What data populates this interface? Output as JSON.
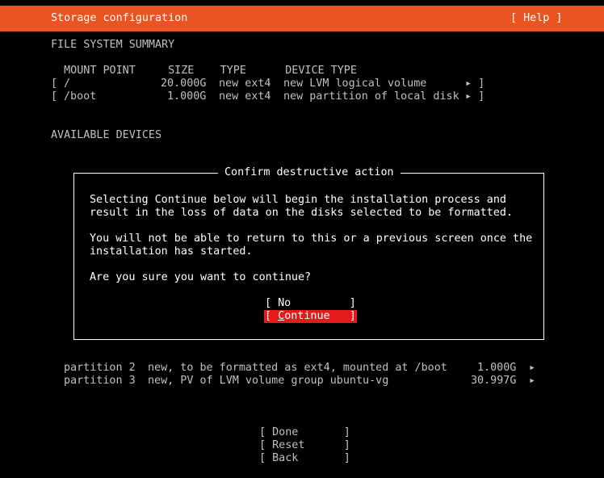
{
  "header": {
    "title": "Storage configuration",
    "help_label": "[ Help ]",
    "accent_color": "#e95420"
  },
  "summary": {
    "heading": "FILE SYSTEM SUMMARY",
    "columns": "  MOUNT POINT     SIZE    TYPE      DEVICE TYPE",
    "rows": [
      {
        "bracket": "[",
        "mount": "/",
        "size": "20.000G",
        "type": "new ext4",
        "device_type": "new LVM logical volume",
        "arrow": "▸ ]"
      },
      {
        "bracket": "[",
        "mount": "/boot",
        "size": "1.000G",
        "type": "new ext4",
        "device_type": "new partition of local disk",
        "arrow": "▸ ]"
      }
    ]
  },
  "available_devices": {
    "heading": "AVAILABLE DEVICES",
    "partitions": [
      {
        "name": "partition 2",
        "desc": "new, to be formatted as ext4, mounted at /boot",
        "size": "1.000G",
        "arrow": "▸"
      },
      {
        "name": "partition 3",
        "desc": "new, PV of LVM volume group ubuntu-vg",
        "size": "30.997G",
        "arrow": "▸"
      }
    ]
  },
  "dialog": {
    "title": "Confirm destructive action",
    "line1": "Selecting Continue below will begin the installation process and",
    "line2": "result in the loss of data on the disks selected to be formatted.",
    "line3": "You will not be able to return to this or a previous screen once the",
    "line4": "installation has started.",
    "question": "Are you sure you want to continue?",
    "no_label": "[ No         ]",
    "continue_label": "[ Continue   ]",
    "focus_color": "#e41b1b"
  },
  "footer": {
    "done_label": "[ Done       ]",
    "reset_label": "[ Reset      ]",
    "back_label": "[ Back       ]"
  }
}
